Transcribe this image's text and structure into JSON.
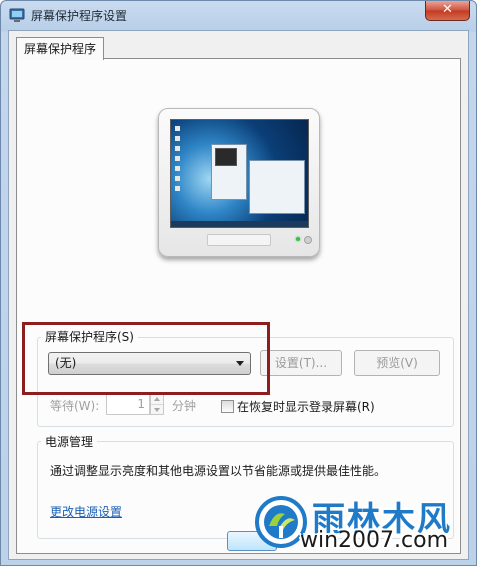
{
  "window": {
    "title": "屏幕保护程序设置",
    "close_label": "✕",
    "icon": "screensaver-app-icon"
  },
  "tabs": [
    {
      "label": "屏幕保护程序",
      "selected": true
    }
  ],
  "screensaver": {
    "group_label": "屏幕保护程序(S)",
    "selected_value": "(无)",
    "settings_button": "设置(T)...",
    "preview_button": "预览(V)",
    "wait_label": "等待(W):",
    "wait_value": "1",
    "wait_unit": "分钟",
    "resume_checkbox_label": "在恢复时显示登录屏幕(R)",
    "resume_checked": false
  },
  "power": {
    "group_label": "电源管理",
    "description": "通过调整显示亮度和其他电源设置以节省能源或提供最佳性能。",
    "link_text": "更改电源设置"
  },
  "watermark": {
    "title": "雨林木风",
    "url": "win2007.com"
  },
  "colors": {
    "highlight_box": "#8e1d1e",
    "link": "#1a5fb4",
    "watermark_blue": "#1f7ac8",
    "close_button": "#c23a22"
  }
}
